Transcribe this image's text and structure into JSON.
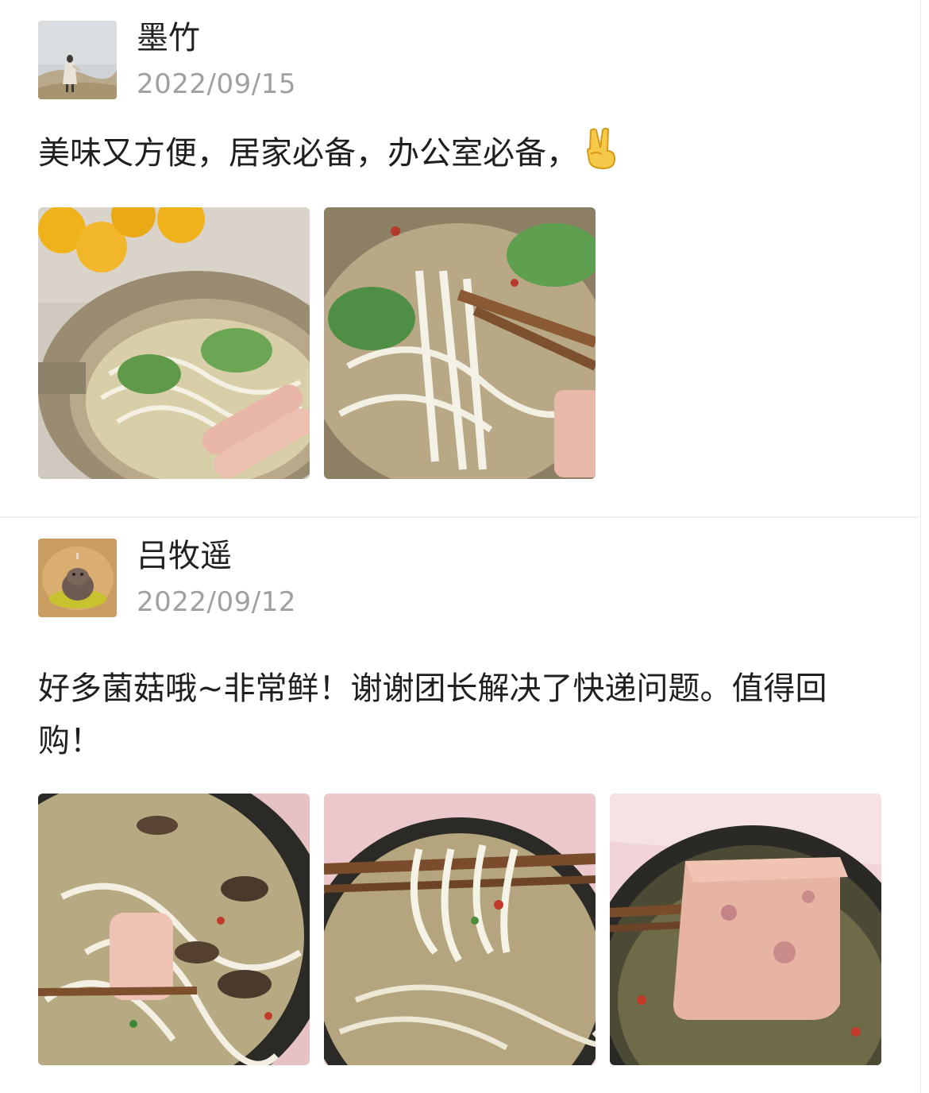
{
  "reviews": [
    {
      "username": "墨竹",
      "date": "2022/09/15",
      "comment": "美味又方便，居家必备，办公室必备，",
      "emoji": "victory-hand-icon",
      "avatar": "desert-walker-avatar",
      "photos": [
        "noodle-pot-photo",
        "chopsticks-lifting-noodles-photo"
      ]
    },
    {
      "username": "吕牧遥",
      "date": "2022/09/12",
      "comment": "好多菌菇哦~非常鲜！谢谢团长解决了快递问题。值得回购！",
      "avatar": "hippo-figurine-avatar",
      "photos": [
        "mushroom-noodle-bowl-photo",
        "noodles-on-chopsticks-photo",
        "luncheon-meat-bowl-photo"
      ]
    }
  ],
  "colors": {
    "username": "#222222",
    "date": "#a0a0a0",
    "text": "#1f1f1f",
    "divider": "#efefef"
  }
}
